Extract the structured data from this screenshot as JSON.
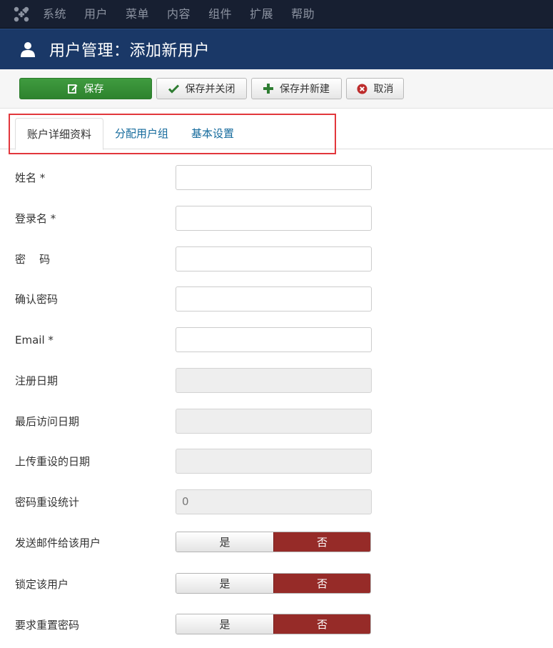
{
  "navbar": {
    "logo_icon": "joomla-logo-icon",
    "menu": [
      "系统",
      "用户",
      "菜单",
      "内容",
      "组件",
      "扩展",
      "帮助"
    ]
  },
  "header": {
    "icon": "user-icon",
    "title": "用户管理：添加新用户"
  },
  "toolbar": {
    "save_label": "保存",
    "save_close_label": "保存并关闭",
    "save_new_label": "保存并新建",
    "cancel_label": "取消"
  },
  "tabs": {
    "items": [
      "账户详细资料",
      "分配用户组",
      "基本设置"
    ],
    "active": "账户详细资料"
  },
  "form": {
    "name_label": "姓名 *",
    "username_label": "登录名 *",
    "password_label": "密    码",
    "password2_label": "确认密码",
    "email_label": "Email *",
    "register_date_label": "注册日期",
    "last_visit_label": "最后访问日期",
    "last_reset_label": "上传重设的日期",
    "reset_count_label": "密码重设统计",
    "reset_count_value": "0",
    "send_email_label": "发送邮件给该用户",
    "block_label": "锁定该用户",
    "require_reset_label": "要求重置密码",
    "yes_label": "是",
    "no_label": "否"
  },
  "colors": {
    "navbar_bg": "#171f31",
    "header_bg": "#1a3867",
    "save_green": "#2e832e",
    "no_red": "#962b28",
    "tab_link": "#146a9c",
    "highlight_box": "#e2373c"
  }
}
